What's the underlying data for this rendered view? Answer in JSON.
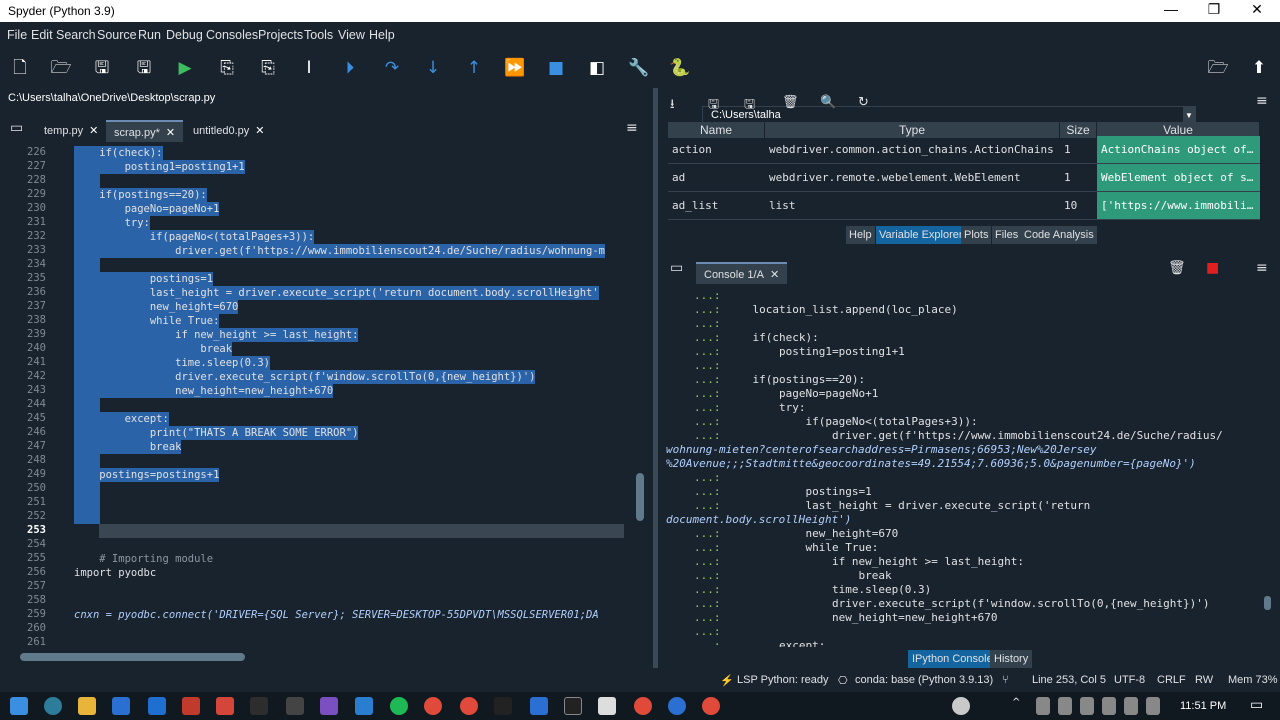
{
  "window": {
    "title": "Spyder (Python 3.9)",
    "min": "—",
    "max": "❐",
    "close": "✕"
  },
  "menu": [
    "File",
    "Edit",
    "Search",
    "Source",
    "Run",
    "Debug",
    "Consoles",
    "Projects",
    "Tools",
    "View",
    "Help"
  ],
  "toolbar": {
    "path": "C:\\Users\\talha"
  },
  "editor": {
    "file_path": "C:\\Users\\talha\\OneDrive\\Desktop\\scrap.py",
    "tabs": [
      {
        "label": "temp.py"
      },
      {
        "label": "scrap.py*"
      },
      {
        "label": "untitled0.py"
      }
    ],
    "line_numbers": [
      "226",
      "227",
      "228",
      "229",
      "230",
      "231",
      "232",
      "233",
      "234",
      "235",
      "236",
      "237",
      "238",
      "239",
      "240",
      "241",
      "242",
      "243",
      "244",
      "245",
      "246",
      "247",
      "248",
      "249",
      "250",
      "251",
      "252",
      "253",
      "254",
      "255",
      "256",
      "257",
      "258",
      "259",
      "260",
      "261"
    ],
    "current_line": "253",
    "lines": [
      "    if(check):",
      "        posting1=posting1+1",
      "",
      "    if(postings==20):",
      "        pageNo=pageNo+1",
      "        try:",
      "            if(pageNo<(totalPages+3)):",
      "                driver.get(f'https://www.immobilienscout24.de/Suche/radius/wohnung-m",
      "",
      "            postings=1",
      "            last_height = driver.execute_script('return document.body.scrollHeight'",
      "            new_height=670",
      "            while True:",
      "                if new_height >= last_height:",
      "                    break",
      "                time.sleep(0.3)",
      "                driver.execute_script(f'window.scrollTo(0,{new_height})')",
      "                new_height=new_height+670",
      "",
      "        except:",
      "            print(\"THATS A BREAK SOME ERROR\")",
      "            break",
      "",
      "    postings=postings+1",
      "",
      "",
      "",
      "",
      "",
      "    # Importing module",
      "import pyodbc",
      "",
      "",
      "cnxn = pyodbc.connect('DRIVER={SQL Server}; SERVER=DESKTOP-55DPVDT\\MSSQLSERVER01;DA",
      "",
      ""
    ]
  },
  "variable_explorer": {
    "columns": [
      "Name",
      "Type",
      "Size",
      "Value"
    ],
    "rows": [
      {
        "name": "action",
        "type": "webdriver.common.action_chains.ActionChains",
        "size": "1",
        "value": "ActionChains object of…"
      },
      {
        "name": "ad",
        "type": "webdriver.remote.webelement.WebElement",
        "size": "1",
        "value": "WebElement object of s…"
      },
      {
        "name": "ad_list",
        "type": "list",
        "size": "10",
        "value": "['https://www.immobili…"
      }
    ],
    "tabs": [
      "Help",
      "Variable Explorer",
      "Plots",
      "Files",
      "Code Analysis"
    ]
  },
  "console": {
    "tab": "Console 1/A",
    "prompt": "...:",
    "lines": [
      {
        "p": "...:",
        "t": ""
      },
      {
        "p": "...:",
        "t": "    location_list.append(loc_place)"
      },
      {
        "p": "...:",
        "t": ""
      },
      {
        "p": "...:",
        "t": "    if(check):"
      },
      {
        "p": "...:",
        "t": "        posting1=posting1+1"
      },
      {
        "p": "...:",
        "t": ""
      },
      {
        "p": "...:",
        "t": "    if(postings==20):"
      },
      {
        "p": "...:",
        "t": "        pageNo=pageNo+1"
      },
      {
        "p": "...:",
        "t": "        try:"
      },
      {
        "p": "...:",
        "t": "            if(pageNo<(totalPages+3)):"
      },
      {
        "p": "...:",
        "t": "                driver.get(f'https://www.immobilienscout24.de/Suche/radius/"
      },
      {
        "p": "",
        "t": "wohnung-mieten?centerofsearchaddress=Pirmasens;66953;New%20Jersey"
      },
      {
        "p": "",
        "t": "%20Avenue;;;Stadtmitte&geocoordinates=49.21554;7.60936;5.0&pagenumber={pageNo}')"
      },
      {
        "p": "...:",
        "t": ""
      },
      {
        "p": "...:",
        "t": "            postings=1"
      },
      {
        "p": "...:",
        "t": "            last_height = driver.execute_script('return"
      },
      {
        "p": "",
        "t": "document.body.scrollHeight')"
      },
      {
        "p": "...:",
        "t": "            new_height=670"
      },
      {
        "p": "...:",
        "t": "            while True:"
      },
      {
        "p": "...:",
        "t": "                if new_height >= last_height:"
      },
      {
        "p": "...:",
        "t": "                    break"
      },
      {
        "p": "...:",
        "t": "                time.sleep(0.3)"
      },
      {
        "p": "...:",
        "t": "                driver.execute_script(f'window.scrollTo(0,{new_height})')"
      },
      {
        "p": "...:",
        "t": "                new_height=new_height+670"
      },
      {
        "p": "...:",
        "t": ""
      },
      {
        "p": "...:",
        "t": "        except:"
      }
    ],
    "bottom_tabs": [
      "IPython Console",
      "History"
    ]
  },
  "status": {
    "lsp": "LSP Python: ready",
    "conda": "conda: base (Python 3.9.13)",
    "position": "Line 253, Col 5",
    "encoding": "UTF-8",
    "eol": "CRLF",
    "rw": "RW",
    "mem": "Mem 73%"
  },
  "taskbar": {
    "time": "11:51 PM"
  },
  "colors": {
    "accent": "#1464a0",
    "selection": "#2b63a8",
    "value_cell": "#2f9a7a"
  }
}
